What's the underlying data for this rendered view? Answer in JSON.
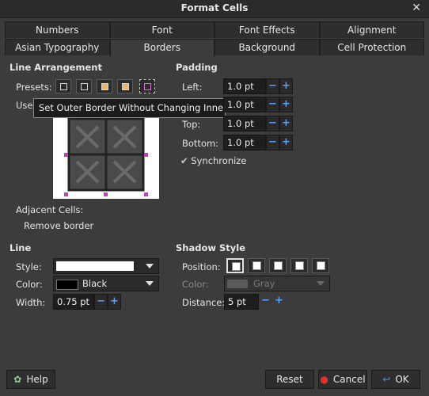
{
  "window": {
    "title": "Format Cells"
  },
  "tabs_row1": [
    "Numbers",
    "Font",
    "Font Effects",
    "Alignment"
  ],
  "tabs_row2": [
    "Asian Typography",
    "Borders",
    "Background",
    "Cell Protection"
  ],
  "line_arrangement": {
    "title": "Line Arrangement",
    "presets_label": "Presets:",
    "user_label": "User",
    "tooltip": "Set Outer Border Without Changing Inner Lines",
    "adjacent_label": "Adjacent Cells:",
    "remove_border": "Remove border"
  },
  "padding": {
    "title": "Padding",
    "left_label": "Left:",
    "left_value": "1.0 pt",
    "right_value": "1.0 pt",
    "top_label": "Top:",
    "top_value": "1.0 pt",
    "bottom_label": "Bottom:",
    "bottom_value": "1.0 pt",
    "synchronize": "Synchronize"
  },
  "line": {
    "title": "Line",
    "style_label": "Style:",
    "color_label": "Color:",
    "color_value": "Black",
    "width_label": "Width:",
    "width_value": "0.75 pt"
  },
  "shadow": {
    "title": "Shadow Style",
    "position_label": "Position:",
    "color_label": "Color:",
    "color_value": "Gray",
    "distance_label": "Distance:",
    "distance_value": "5 pt"
  },
  "buttons": {
    "help": "Help",
    "reset": "Reset",
    "cancel": "Cancel",
    "ok": "OK"
  },
  "colors": {
    "accent": "#5aa0ff",
    "preview_marker": "#c040c0",
    "cancel_icon": "#e03030"
  }
}
